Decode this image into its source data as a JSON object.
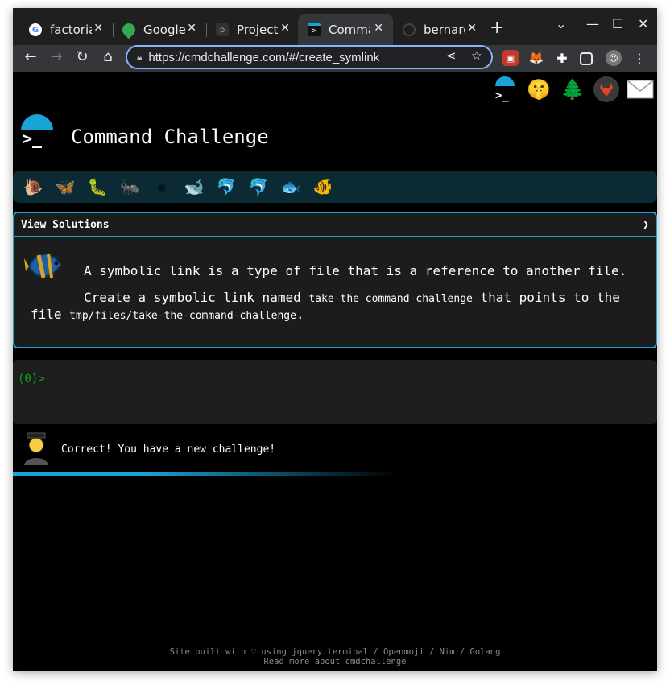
{
  "browser": {
    "tabs": [
      {
        "title": "factoria",
        "favicon": "google-favicon",
        "active": false
      },
      {
        "title": "Google",
        "favicon": "maps-favicon",
        "active": false
      },
      {
        "title": "Project",
        "favicon": "project-favicon",
        "active": false
      },
      {
        "title": "Comma",
        "favicon": "terminal-favicon",
        "active": true
      },
      {
        "title": "bernard",
        "favicon": "github-favicon",
        "active": false
      }
    ],
    "url": "https://cmdchallenge.com/#/create_symlink"
  },
  "header": {
    "site_title": "Command Challenge",
    "top_icons": [
      "terminal-logo-icon",
      "shushing-face-icon",
      "tree-icon",
      "gitlab-icon",
      "mail-icon"
    ]
  },
  "animals": [
    "snail",
    "butterfly",
    "caterpillar",
    "ant",
    "virus",
    "whale",
    "dolphin",
    "dolphin",
    "fish",
    "tropical-fish"
  ],
  "challenge": {
    "solutions_label": "View Solutions",
    "line1": "A symbolic link is a type of file that is a reference to another file.",
    "line2_pre": "Create a symbolic link named ",
    "link_name": "take-the-command-challenge",
    "line2_mid": " that points to the file ",
    "target_path": "tmp/files/take-the-command-challenge",
    "line2_end": "."
  },
  "terminal": {
    "count": "(0)",
    "prompt": ">"
  },
  "result": {
    "message": "Correct! You have a new challenge!"
  },
  "footer": {
    "line1": "Site built with ♡ using jquery.terminal / Openmoji / Nim / Golang",
    "line2": "Read more about cmdchallenge"
  }
}
